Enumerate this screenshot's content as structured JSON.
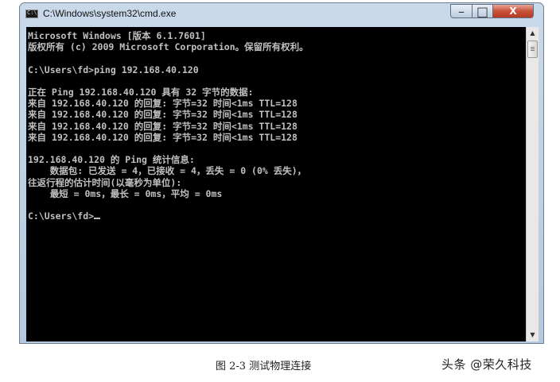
{
  "window": {
    "title": "C:\\Windows\\system32\\cmd.exe",
    "controls": {
      "minimize": "–",
      "maximize": "□",
      "close": "X"
    }
  },
  "console": {
    "lines": [
      "Microsoft Windows [版本 6.1.7601]",
      "版权所有 (c) 2009 Microsoft Corporation。保留所有权利。",
      "",
      "C:\\Users\\fd>ping 192.168.40.120",
      "",
      "正在 Ping 192.168.40.120 具有 32 字节的数据:",
      "来自 192.168.40.120 的回复: 字节=32 时间<1ms TTL=128",
      "来自 192.168.40.120 的回复: 字节=32 时间<1ms TTL=128",
      "来自 192.168.40.120 的回复: 字节=32 时间<1ms TTL=128",
      "来自 192.168.40.120 的回复: 字节=32 时间<1ms TTL=128",
      "",
      "192.168.40.120 的 Ping 统计信息:",
      "    数据包: 已发送 = 4，已接收 = 4，丢失 = 0 (0% 丢失)，",
      "往返行程的估计时间(以毫秒为单位):",
      "    最短 = 0ms，最长 = 0ms，平均 = 0ms",
      "",
      "C:\\Users\\fd>"
    ]
  },
  "scrollbar": {
    "up_arrow": "▲",
    "down_arrow": "▼"
  },
  "caption": "图 2-3  测试物理连接",
  "watermark": "头条 @荣久科技"
}
